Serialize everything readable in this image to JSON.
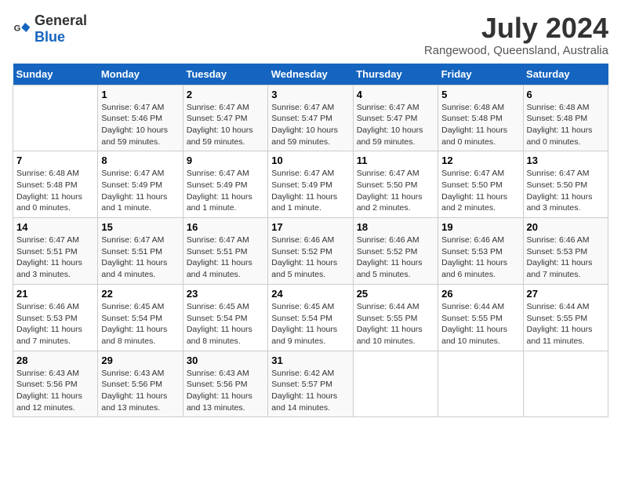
{
  "header": {
    "logo_general": "General",
    "logo_blue": "Blue",
    "title": "July 2024",
    "subtitle": "Rangewood, Queensland, Australia"
  },
  "calendar": {
    "days_of_week": [
      "Sunday",
      "Monday",
      "Tuesday",
      "Wednesday",
      "Thursday",
      "Friday",
      "Saturday"
    ],
    "weeks": [
      [
        {
          "day": "",
          "info": ""
        },
        {
          "day": "1",
          "info": "Sunrise: 6:47 AM\nSunset: 5:46 PM\nDaylight: 10 hours\nand 59 minutes."
        },
        {
          "day": "2",
          "info": "Sunrise: 6:47 AM\nSunset: 5:47 PM\nDaylight: 10 hours\nand 59 minutes."
        },
        {
          "day": "3",
          "info": "Sunrise: 6:47 AM\nSunset: 5:47 PM\nDaylight: 10 hours\nand 59 minutes."
        },
        {
          "day": "4",
          "info": "Sunrise: 6:47 AM\nSunset: 5:47 PM\nDaylight: 10 hours\nand 59 minutes."
        },
        {
          "day": "5",
          "info": "Sunrise: 6:48 AM\nSunset: 5:48 PM\nDaylight: 11 hours\nand 0 minutes."
        },
        {
          "day": "6",
          "info": "Sunrise: 6:48 AM\nSunset: 5:48 PM\nDaylight: 11 hours\nand 0 minutes."
        }
      ],
      [
        {
          "day": "7",
          "info": "Sunrise: 6:48 AM\nSunset: 5:48 PM\nDaylight: 11 hours\nand 0 minutes."
        },
        {
          "day": "8",
          "info": "Sunrise: 6:47 AM\nSunset: 5:49 PM\nDaylight: 11 hours\nand 1 minute."
        },
        {
          "day": "9",
          "info": "Sunrise: 6:47 AM\nSunset: 5:49 PM\nDaylight: 11 hours\nand 1 minute."
        },
        {
          "day": "10",
          "info": "Sunrise: 6:47 AM\nSunset: 5:49 PM\nDaylight: 11 hours\nand 1 minute."
        },
        {
          "day": "11",
          "info": "Sunrise: 6:47 AM\nSunset: 5:50 PM\nDaylight: 11 hours\nand 2 minutes."
        },
        {
          "day": "12",
          "info": "Sunrise: 6:47 AM\nSunset: 5:50 PM\nDaylight: 11 hours\nand 2 minutes."
        },
        {
          "day": "13",
          "info": "Sunrise: 6:47 AM\nSunset: 5:50 PM\nDaylight: 11 hours\nand 3 minutes."
        }
      ],
      [
        {
          "day": "14",
          "info": "Sunrise: 6:47 AM\nSunset: 5:51 PM\nDaylight: 11 hours\nand 3 minutes."
        },
        {
          "day": "15",
          "info": "Sunrise: 6:47 AM\nSunset: 5:51 PM\nDaylight: 11 hours\nand 4 minutes."
        },
        {
          "day": "16",
          "info": "Sunrise: 6:47 AM\nSunset: 5:51 PM\nDaylight: 11 hours\nand 4 minutes."
        },
        {
          "day": "17",
          "info": "Sunrise: 6:46 AM\nSunset: 5:52 PM\nDaylight: 11 hours\nand 5 minutes."
        },
        {
          "day": "18",
          "info": "Sunrise: 6:46 AM\nSunset: 5:52 PM\nDaylight: 11 hours\nand 5 minutes."
        },
        {
          "day": "19",
          "info": "Sunrise: 6:46 AM\nSunset: 5:53 PM\nDaylight: 11 hours\nand 6 minutes."
        },
        {
          "day": "20",
          "info": "Sunrise: 6:46 AM\nSunset: 5:53 PM\nDaylight: 11 hours\nand 7 minutes."
        }
      ],
      [
        {
          "day": "21",
          "info": "Sunrise: 6:46 AM\nSunset: 5:53 PM\nDaylight: 11 hours\nand 7 minutes."
        },
        {
          "day": "22",
          "info": "Sunrise: 6:45 AM\nSunset: 5:54 PM\nDaylight: 11 hours\nand 8 minutes."
        },
        {
          "day": "23",
          "info": "Sunrise: 6:45 AM\nSunset: 5:54 PM\nDaylight: 11 hours\nand 8 minutes."
        },
        {
          "day": "24",
          "info": "Sunrise: 6:45 AM\nSunset: 5:54 PM\nDaylight: 11 hours\nand 9 minutes."
        },
        {
          "day": "25",
          "info": "Sunrise: 6:44 AM\nSunset: 5:55 PM\nDaylight: 11 hours\nand 10 minutes."
        },
        {
          "day": "26",
          "info": "Sunrise: 6:44 AM\nSunset: 5:55 PM\nDaylight: 11 hours\nand 10 minutes."
        },
        {
          "day": "27",
          "info": "Sunrise: 6:44 AM\nSunset: 5:55 PM\nDaylight: 11 hours\nand 11 minutes."
        }
      ],
      [
        {
          "day": "28",
          "info": "Sunrise: 6:43 AM\nSunset: 5:56 PM\nDaylight: 11 hours\nand 12 minutes."
        },
        {
          "day": "29",
          "info": "Sunrise: 6:43 AM\nSunset: 5:56 PM\nDaylight: 11 hours\nand 13 minutes."
        },
        {
          "day": "30",
          "info": "Sunrise: 6:43 AM\nSunset: 5:56 PM\nDaylight: 11 hours\nand 13 minutes."
        },
        {
          "day": "31",
          "info": "Sunrise: 6:42 AM\nSunset: 5:57 PM\nDaylight: 11 hours\nand 14 minutes."
        },
        {
          "day": "",
          "info": ""
        },
        {
          "day": "",
          "info": ""
        },
        {
          "day": "",
          "info": ""
        }
      ]
    ]
  }
}
